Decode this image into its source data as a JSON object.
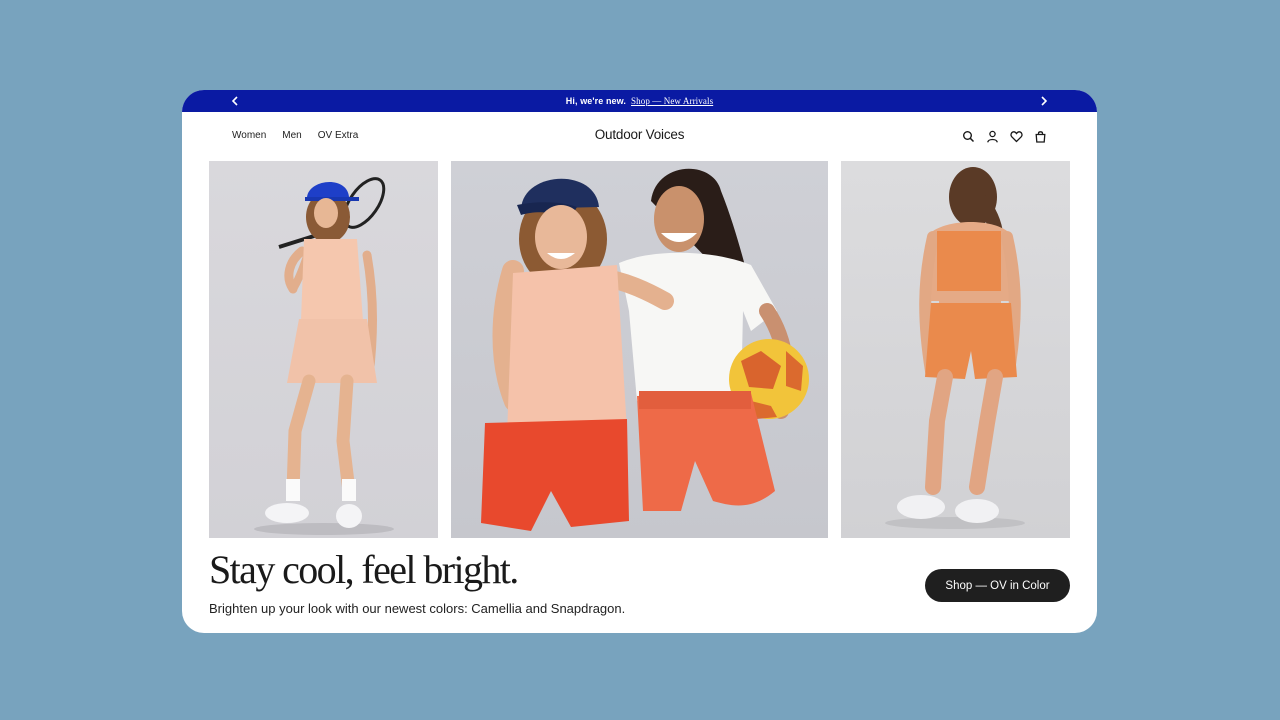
{
  "promo_bar": {
    "lead_text": "Hi, we're new.",
    "link_text": "Shop — New Arrivals",
    "background": "#0a1aa3"
  },
  "nav": {
    "links": [
      "Women",
      "Men",
      "OV Extra"
    ],
    "brand": "Outdoor Voices",
    "icons": [
      "search-icon",
      "account-icon",
      "wishlist-heart-icon",
      "shopping-bag-icon"
    ]
  },
  "hero": {
    "photos": [
      {
        "name": "tennis-outfit-photo",
        "colors": {
          "top": "#f5c7ae",
          "accent": "#1e3fc8"
        }
      },
      {
        "name": "soccer-duo-photo",
        "colors": {
          "shorts": "#e85a3c",
          "ball": "#f2c43a"
        }
      },
      {
        "name": "bike-short-back-photo",
        "colors": {
          "set": "#ea8a4c"
        }
      }
    ],
    "headline": "Stay cool, feel bright.",
    "subheadline": "Brighten up your look with our newest colors: Camellia and Snapdragon.",
    "cta_label": "Shop — OV in Color"
  },
  "colors": {
    "page_background": "#78a3be",
    "cta_background": "#1f1f1f"
  }
}
